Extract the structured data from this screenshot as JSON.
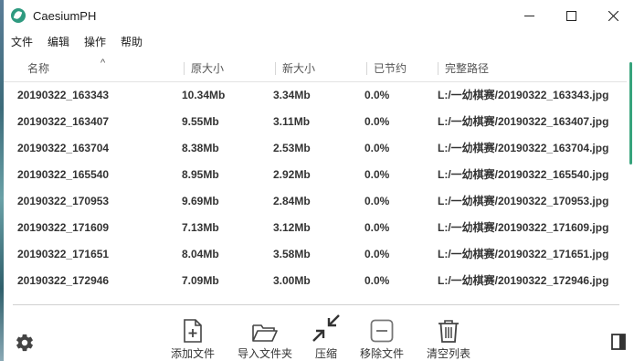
{
  "window": {
    "title": "CaesiumPH",
    "icon": "caesium-leaf-icon",
    "accent": "#37a37c"
  },
  "menu": [
    "文件",
    "编辑",
    "操作",
    "帮助"
  ],
  "table": {
    "columns": [
      "名称",
      "原大小",
      "新大小",
      "已节约",
      "完整路径"
    ],
    "sort_indicator": "^",
    "rows": [
      {
        "name": "20190322_163343",
        "orig": "10.34Mb",
        "new": "3.34Mb",
        "saved": "0.0%",
        "path": "L:/一幼棋赛/20190322_163343.jpg"
      },
      {
        "name": "20190322_163407",
        "orig": "9.55Mb",
        "new": "3.11Mb",
        "saved": "0.0%",
        "path": "L:/一幼棋赛/20190322_163407.jpg"
      },
      {
        "name": "20190322_163704",
        "orig": "8.38Mb",
        "new": "2.53Mb",
        "saved": "0.0%",
        "path": "L:/一幼棋赛/20190322_163704.jpg"
      },
      {
        "name": "20190322_165540",
        "orig": "8.95Mb",
        "new": "2.92Mb",
        "saved": "0.0%",
        "path": "L:/一幼棋赛/20190322_165540.jpg"
      },
      {
        "name": "20190322_170953",
        "orig": "9.69Mb",
        "new": "2.84Mb",
        "saved": "0.0%",
        "path": "L:/一幼棋赛/20190322_170953.jpg"
      },
      {
        "name": "20190322_171609",
        "orig": "7.13Mb",
        "new": "3.12Mb",
        "saved": "0.0%",
        "path": "L:/一幼棋赛/20190322_171609.jpg"
      },
      {
        "name": "20190322_171651",
        "orig": "8.04Mb",
        "new": "3.58Mb",
        "saved": "0.0%",
        "path": "L:/一幼棋赛/20190322_171651.jpg"
      },
      {
        "name": "20190322_172946",
        "orig": "7.09Mb",
        "new": "3.00Mb",
        "saved": "0.0%",
        "path": "L:/一幼棋赛/20190322_172946.jpg"
      }
    ]
  },
  "toolbar": {
    "add_files": "添加文件",
    "import_folder": "导入文件夹",
    "compress": "压缩",
    "remove_files": "移除文件",
    "clear_list": "清空列表"
  }
}
